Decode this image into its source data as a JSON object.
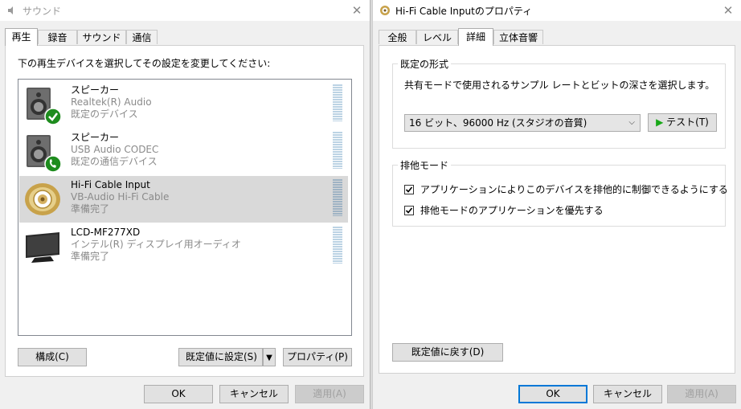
{
  "left_window": {
    "title": "サウンド",
    "tabs": [
      "再生",
      "録音",
      "サウンド",
      "通信"
    ],
    "instruction": "下の再生デバイスを選択してその設定を変更してください:",
    "devices": [
      {
        "name": "スピーカー",
        "driver": "Realtek(R) Audio",
        "status": "既定のデバイス",
        "icon": "speaker-icon",
        "badge": "check-badge-icon"
      },
      {
        "name": "スピーカー",
        "driver": "USB Audio CODEC",
        "status": "既定の通信デバイス",
        "icon": "speaker-icon",
        "badge": "phone-badge-icon"
      },
      {
        "name": "Hi-Fi Cable Input",
        "driver": "VB-Audio Hi-Fi Cable",
        "status": "準備完了",
        "icon": "rca-connector-icon",
        "selected": true
      },
      {
        "name": "LCD-MF277XD",
        "driver": "インテル(R) ディスプレイ用オーディオ",
        "status": "準備完了",
        "icon": "monitor-icon"
      }
    ],
    "configure_label": "構成(C)",
    "set_default_label": "既定値に設定(S)",
    "properties_label": "プロパティ(P)",
    "ok_label": "OK",
    "cancel_label": "キャンセル",
    "apply_label": "適用(A)"
  },
  "right_window": {
    "title": "Hi-Fi Cable Inputのプロパティ",
    "tabs": [
      "全般",
      "レベル",
      "詳細",
      "立体音響"
    ],
    "default_format_group": "既定の形式",
    "default_format_desc": "共有モードで使用されるサンプル レートとビットの深さを選択します。",
    "format_selected": "16 ビット、96000 Hz (スタジオの音質)",
    "test_label": "テスト(T)",
    "exclusive_group": "排他モード",
    "exclusive_option1": "アプリケーションによりこのデバイスを排他的に制御できるようにする",
    "exclusive_option2": "排他モードのアプリケーションを優先する",
    "exclusive_option1_checked": true,
    "exclusive_option2_checked": true,
    "restore_defaults_label": "既定値に戻す(D)",
    "ok_label": "OK",
    "cancel_label": "キャンセル",
    "apply_label": "適用(A)"
  },
  "colors": {
    "accent": "#0078d7",
    "selection": "#d9d9d9",
    "check_green": "#1e8c1e",
    "play_green": "#18a818"
  }
}
